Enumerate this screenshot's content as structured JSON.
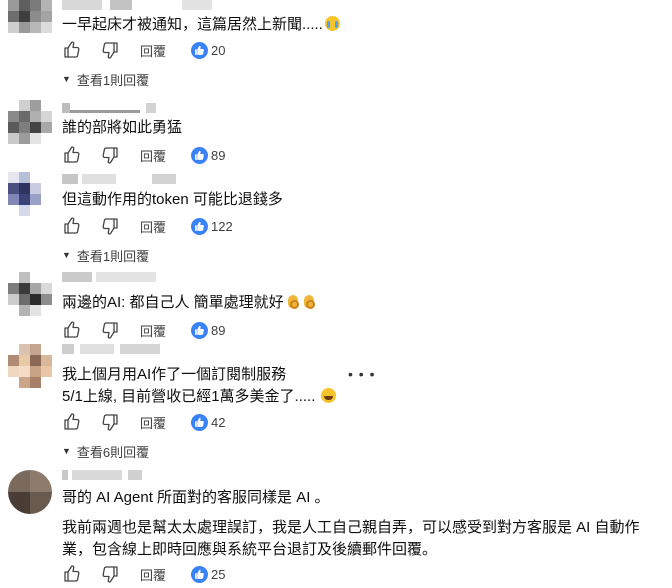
{
  "comments": [
    {
      "text_lines": [
        "一早起床才被通知，這篇居然上新聞....."
      ],
      "emoji": "cry",
      "reply_label": "回覆",
      "likes": "20",
      "view_replies": "查看1則回覆"
    },
    {
      "text_lines": [
        "誰的部將如此勇猛"
      ],
      "emoji": "",
      "reply_label": "回覆",
      "likes": "89",
      "view_replies": ""
    },
    {
      "text_lines": [
        "但這動作用的token 可能比退錢多"
      ],
      "emoji": "",
      "reply_label": "回覆",
      "likes": "122",
      "view_replies": "查看1則回覆"
    },
    {
      "text_lines": [
        "兩邊的AI: 都自己人 簡單處理就好"
      ],
      "emoji": "ok-ok",
      "reply_label": "回覆",
      "likes": "89",
      "view_replies": ""
    },
    {
      "text_lines": [
        "我上個月用AI作了一個訂閱制服務",
        "5/1上線, 目前營收已經1萬多美金了....."
      ],
      "emoji": "laugh",
      "reply_label": "回覆",
      "likes": "42",
      "view_replies": "查看6則回覆",
      "more_icon": "more-dots-icon"
    },
    {
      "text_lines": [
        "哥的 AI Agent 所面對的客服同樣是 AI 。"
      ],
      "text_paragraph2": "我前兩週也是幫太太處理誤訂，我是人工自己親自弄，可以感受到對方客服是 AI 自動作業，包含線上即時回應與系統平台退訂及後續郵件回覆。",
      "emoji": "",
      "reply_label": "回覆",
      "likes": "25",
      "view_replies": ""
    }
  ],
  "icons": {
    "like": "thumbs-up-icon",
    "dislike": "thumbs-down-icon",
    "badge": "like-badge-icon",
    "expand": "chevron-down-icon"
  },
  "colors": {
    "like_badge": "#3b82f6",
    "text": "#0f0f0f",
    "secondary": "#3f3f3f"
  }
}
